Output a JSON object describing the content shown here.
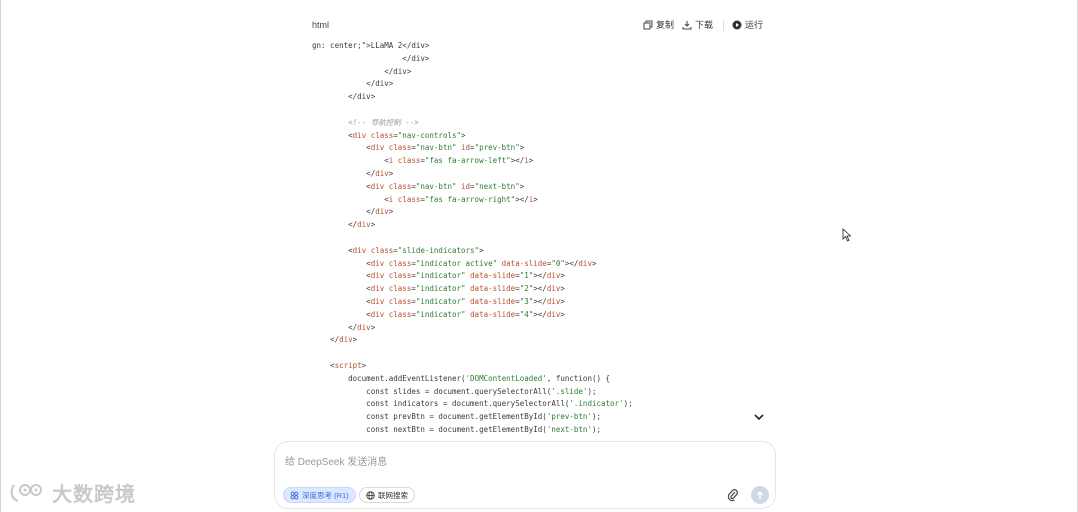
{
  "code_header": {
    "language": "html",
    "copy_label": "复制",
    "download_label": "下载",
    "run_label": "运行"
  },
  "code_lines": [
    [
      {
        "t": "plain",
        "v": "gn: center;\">LLaMA 2</div>"
      }
    ],
    [
      {
        "t": "plain",
        "v": "                    </div>"
      }
    ],
    [
      {
        "t": "plain",
        "v": "                </div>"
      }
    ],
    [
      {
        "t": "plain",
        "v": "            </div>"
      }
    ],
    [
      {
        "t": "plain",
        "v": "        </div>"
      }
    ],
    [
      {
        "t": "plain",
        "v": ""
      }
    ],
    [
      {
        "t": "cmt",
        "v": "        <!-- 导航控制 -->"
      }
    ],
    [
      {
        "t": "plain",
        "v": "        <"
      },
      {
        "t": "tag",
        "v": "div"
      },
      {
        "t": "plain",
        "v": " "
      },
      {
        "t": "attr",
        "v": "class"
      },
      {
        "t": "plain",
        "v": "="
      },
      {
        "t": "str",
        "v": "\"nav-controls\""
      },
      {
        "t": "plain",
        "v": ">"
      }
    ],
    [
      {
        "t": "plain",
        "v": "            <"
      },
      {
        "t": "tag",
        "v": "div"
      },
      {
        "t": "plain",
        "v": " "
      },
      {
        "t": "attr",
        "v": "class"
      },
      {
        "t": "plain",
        "v": "="
      },
      {
        "t": "str",
        "v": "\"nav-btn\""
      },
      {
        "t": "plain",
        "v": " "
      },
      {
        "t": "attr",
        "v": "id"
      },
      {
        "t": "plain",
        "v": "="
      },
      {
        "t": "str",
        "v": "\"prev-btn\""
      },
      {
        "t": "plain",
        "v": ">"
      }
    ],
    [
      {
        "t": "plain",
        "v": "                <"
      },
      {
        "t": "tag",
        "v": "i"
      },
      {
        "t": "plain",
        "v": " "
      },
      {
        "t": "attr",
        "v": "class"
      },
      {
        "t": "plain",
        "v": "="
      },
      {
        "t": "str",
        "v": "\"fas fa-arrow-left\""
      },
      {
        "t": "plain",
        "v": "></"
      },
      {
        "t": "tag",
        "v": "i"
      },
      {
        "t": "plain",
        "v": ">"
      }
    ],
    [
      {
        "t": "plain",
        "v": "            </"
      },
      {
        "t": "tag",
        "v": "div"
      },
      {
        "t": "plain",
        "v": ">"
      }
    ],
    [
      {
        "t": "plain",
        "v": "            <"
      },
      {
        "t": "tag",
        "v": "div"
      },
      {
        "t": "plain",
        "v": " "
      },
      {
        "t": "attr",
        "v": "class"
      },
      {
        "t": "plain",
        "v": "="
      },
      {
        "t": "str",
        "v": "\"nav-btn\""
      },
      {
        "t": "plain",
        "v": " "
      },
      {
        "t": "attr",
        "v": "id"
      },
      {
        "t": "plain",
        "v": "="
      },
      {
        "t": "str",
        "v": "\"next-btn\""
      },
      {
        "t": "plain",
        "v": ">"
      }
    ],
    [
      {
        "t": "plain",
        "v": "                <"
      },
      {
        "t": "tag",
        "v": "i"
      },
      {
        "t": "plain",
        "v": " "
      },
      {
        "t": "attr",
        "v": "class"
      },
      {
        "t": "plain",
        "v": "="
      },
      {
        "t": "str",
        "v": "\"fas fa-arrow-right\""
      },
      {
        "t": "plain",
        "v": "></"
      },
      {
        "t": "tag",
        "v": "i"
      },
      {
        "t": "plain",
        "v": ">"
      }
    ],
    [
      {
        "t": "plain",
        "v": "            </"
      },
      {
        "t": "tag",
        "v": "div"
      },
      {
        "t": "plain",
        "v": ">"
      }
    ],
    [
      {
        "t": "plain",
        "v": "        </"
      },
      {
        "t": "tag",
        "v": "div"
      },
      {
        "t": "plain",
        "v": ">"
      }
    ],
    [
      {
        "t": "plain",
        "v": ""
      }
    ],
    [
      {
        "t": "plain",
        "v": "        <"
      },
      {
        "t": "tag",
        "v": "div"
      },
      {
        "t": "plain",
        "v": " "
      },
      {
        "t": "attr",
        "v": "class"
      },
      {
        "t": "plain",
        "v": "="
      },
      {
        "t": "str",
        "v": "\"slide-indicators\""
      },
      {
        "t": "plain",
        "v": ">"
      }
    ],
    [
      {
        "t": "plain",
        "v": "            <"
      },
      {
        "t": "tag",
        "v": "div"
      },
      {
        "t": "plain",
        "v": " "
      },
      {
        "t": "attr",
        "v": "class"
      },
      {
        "t": "plain",
        "v": "="
      },
      {
        "t": "str",
        "v": "\"indicator active\""
      },
      {
        "t": "plain",
        "v": " "
      },
      {
        "t": "attr",
        "v": "data-slide"
      },
      {
        "t": "plain",
        "v": "="
      },
      {
        "t": "str",
        "v": "\"0\""
      },
      {
        "t": "plain",
        "v": "></"
      },
      {
        "t": "tag",
        "v": "div"
      },
      {
        "t": "plain",
        "v": ">"
      }
    ],
    [
      {
        "t": "plain",
        "v": "            <"
      },
      {
        "t": "tag",
        "v": "div"
      },
      {
        "t": "plain",
        "v": " "
      },
      {
        "t": "attr",
        "v": "class"
      },
      {
        "t": "plain",
        "v": "="
      },
      {
        "t": "str",
        "v": "\"indicator\""
      },
      {
        "t": "plain",
        "v": " "
      },
      {
        "t": "attr",
        "v": "data-slide"
      },
      {
        "t": "plain",
        "v": "="
      },
      {
        "t": "str",
        "v": "\"1\""
      },
      {
        "t": "plain",
        "v": "></"
      },
      {
        "t": "tag",
        "v": "div"
      },
      {
        "t": "plain",
        "v": ">"
      }
    ],
    [
      {
        "t": "plain",
        "v": "            <"
      },
      {
        "t": "tag",
        "v": "div"
      },
      {
        "t": "plain",
        "v": " "
      },
      {
        "t": "attr",
        "v": "class"
      },
      {
        "t": "plain",
        "v": "="
      },
      {
        "t": "str",
        "v": "\"indicator\""
      },
      {
        "t": "plain",
        "v": " "
      },
      {
        "t": "attr",
        "v": "data-slide"
      },
      {
        "t": "plain",
        "v": "="
      },
      {
        "t": "str",
        "v": "\"2\""
      },
      {
        "t": "plain",
        "v": "></"
      },
      {
        "t": "tag",
        "v": "div"
      },
      {
        "t": "plain",
        "v": ">"
      }
    ],
    [
      {
        "t": "plain",
        "v": "            <"
      },
      {
        "t": "tag",
        "v": "div"
      },
      {
        "t": "plain",
        "v": " "
      },
      {
        "t": "attr",
        "v": "class"
      },
      {
        "t": "plain",
        "v": "="
      },
      {
        "t": "str",
        "v": "\"indicator\""
      },
      {
        "t": "plain",
        "v": " "
      },
      {
        "t": "attr",
        "v": "data-slide"
      },
      {
        "t": "plain",
        "v": "="
      },
      {
        "t": "str",
        "v": "\"3\""
      },
      {
        "t": "plain",
        "v": "></"
      },
      {
        "t": "tag",
        "v": "div"
      },
      {
        "t": "plain",
        "v": ">"
      }
    ],
    [
      {
        "t": "plain",
        "v": "            <"
      },
      {
        "t": "tag",
        "v": "div"
      },
      {
        "t": "plain",
        "v": " "
      },
      {
        "t": "attr",
        "v": "class"
      },
      {
        "t": "plain",
        "v": "="
      },
      {
        "t": "str",
        "v": "\"indicator\""
      },
      {
        "t": "plain",
        "v": " "
      },
      {
        "t": "attr",
        "v": "data-slide"
      },
      {
        "t": "plain",
        "v": "="
      },
      {
        "t": "str",
        "v": "\"4\""
      },
      {
        "t": "plain",
        "v": "></"
      },
      {
        "t": "tag",
        "v": "div"
      },
      {
        "t": "plain",
        "v": ">"
      }
    ],
    [
      {
        "t": "plain",
        "v": "        </"
      },
      {
        "t": "tag",
        "v": "div"
      },
      {
        "t": "plain",
        "v": ">"
      }
    ],
    [
      {
        "t": "plain",
        "v": "    </"
      },
      {
        "t": "tag",
        "v": "div"
      },
      {
        "t": "plain",
        "v": ">"
      }
    ],
    [
      {
        "t": "plain",
        "v": ""
      }
    ],
    [
      {
        "t": "plain",
        "v": "    <"
      },
      {
        "t": "tag",
        "v": "script"
      },
      {
        "t": "plain",
        "v": ">"
      }
    ],
    [
      {
        "t": "plain",
        "v": "        document.addEventListener("
      },
      {
        "t": "str",
        "v": "'DOMContentLoaded'"
      },
      {
        "t": "plain",
        "v": ", function() {"
      }
    ],
    [
      {
        "t": "plain",
        "v": "            const slides = document.querySelectorAll("
      },
      {
        "t": "str",
        "v": "'.slide'"
      },
      {
        "t": "plain",
        "v": ");"
      }
    ],
    [
      {
        "t": "plain",
        "v": "            const indicators = document.querySelectorAll("
      },
      {
        "t": "str",
        "v": "'.indicator'"
      },
      {
        "t": "plain",
        "v": ");"
      }
    ],
    [
      {
        "t": "plain",
        "v": "            const prevBtn = document.getElementById("
      },
      {
        "t": "str",
        "v": "'prev-btn'"
      },
      {
        "t": "plain",
        "v": ");"
      }
    ],
    [
      {
        "t": "plain",
        "v": "            const nextBtn = document.getElementById("
      },
      {
        "t": "str",
        "v": "'next-btn'"
      },
      {
        "t": "plain",
        "v": ");"
      }
    ]
  ],
  "input": {
    "placeholder": "给 DeepSeek 发送消息",
    "deep_think_label": "深度思考 (R1)",
    "web_search_label": "联网搜索"
  },
  "watermark": {
    "text": "大数跨境"
  },
  "colors": {
    "chip_active_bg": "#dbe8ff",
    "chip_active_text": "#3b6fd8",
    "send_button": "#cfd8e6"
  }
}
